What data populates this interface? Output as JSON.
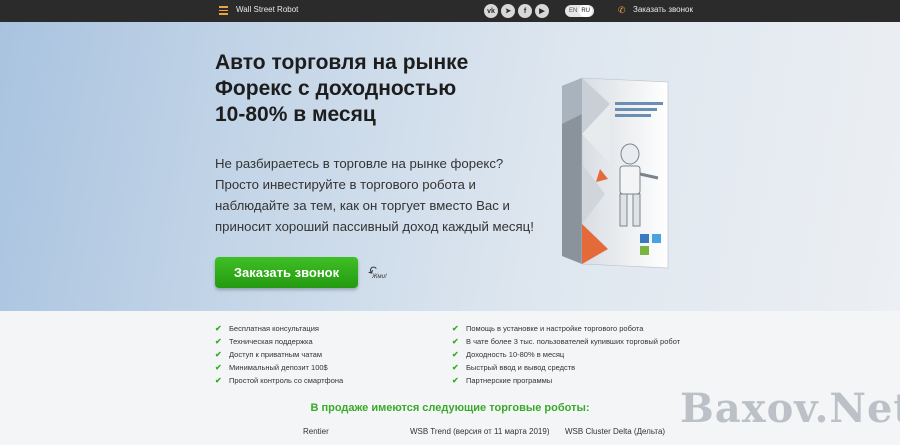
{
  "header": {
    "brand": "Wall Street Robot",
    "socials": [
      "vk-icon",
      "telegram-icon",
      "facebook-icon",
      "youtube-icon"
    ],
    "languages": [
      "EN",
      "RU"
    ],
    "active_language": "RU",
    "call_link": "Заказать звонок"
  },
  "hero": {
    "title_lines": [
      "Авто торговля на рынке",
      "Форекс с доходностью",
      "10-80% в месяц"
    ],
    "text_lines": [
      "Не разбираетесь в торговле на рынке форекс?",
      "Просто инвестируйте в торгового робота и",
      "наблюдайте за тем, как он торгует вместо Вас и",
      "приносит хороший пассивный доход каждый месяц!"
    ],
    "cta_label": "Заказать звонок",
    "press_hint": "Жми!"
  },
  "features": {
    "left": [
      "Бесплатная консультация",
      "Техническая поддержка",
      "Доступ к приватным чатам",
      "Минимальный депозит 100$",
      "Простой контроль со смартфона"
    ],
    "right": [
      "Помощь в установке и настройке торгового робота",
      "В чате более 3 тыс. пользователей купивших торговый робот",
      "Доходность 10-80% в месяц",
      "Быстрый ввод и вывод средств",
      "Партнерские программы"
    ]
  },
  "sale": {
    "title": "В продаже имеются следующие торговые роботы:",
    "robots": [
      "Rentier",
      "WSB Trend (версия от 11 марта 2019)",
      "WSB Cluster Delta (Дельта)"
    ]
  },
  "watermark": "Baxov.Net",
  "colors": {
    "accent_green": "#3aaa2a",
    "topbar": "#2b2b2b",
    "orange": "#f0a23b"
  }
}
